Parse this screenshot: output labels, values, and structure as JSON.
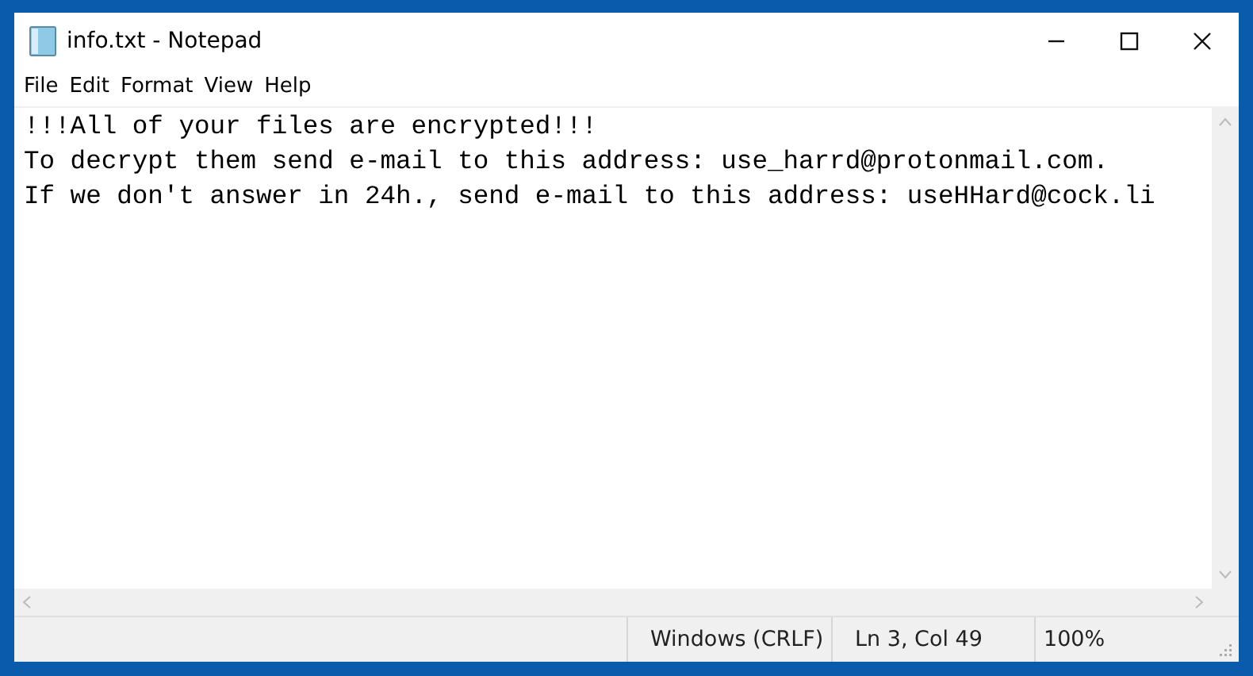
{
  "window": {
    "title": "info.txt - Notepad"
  },
  "menu": [
    "File",
    "Edit",
    "Format",
    "View",
    "Help"
  ],
  "document": {
    "lines": [
      "!!!All of your files are encrypted!!!",
      "To decrypt them send e-mail to this address: use_harrd@protonmail.com.",
      "If we don't answer in 24h., send e-mail to this address: useHHard@cock.li"
    ]
  },
  "status_bar": [
    "Windows (CRLF)",
    "Ln 3, Col 49",
    "100%"
  ]
}
